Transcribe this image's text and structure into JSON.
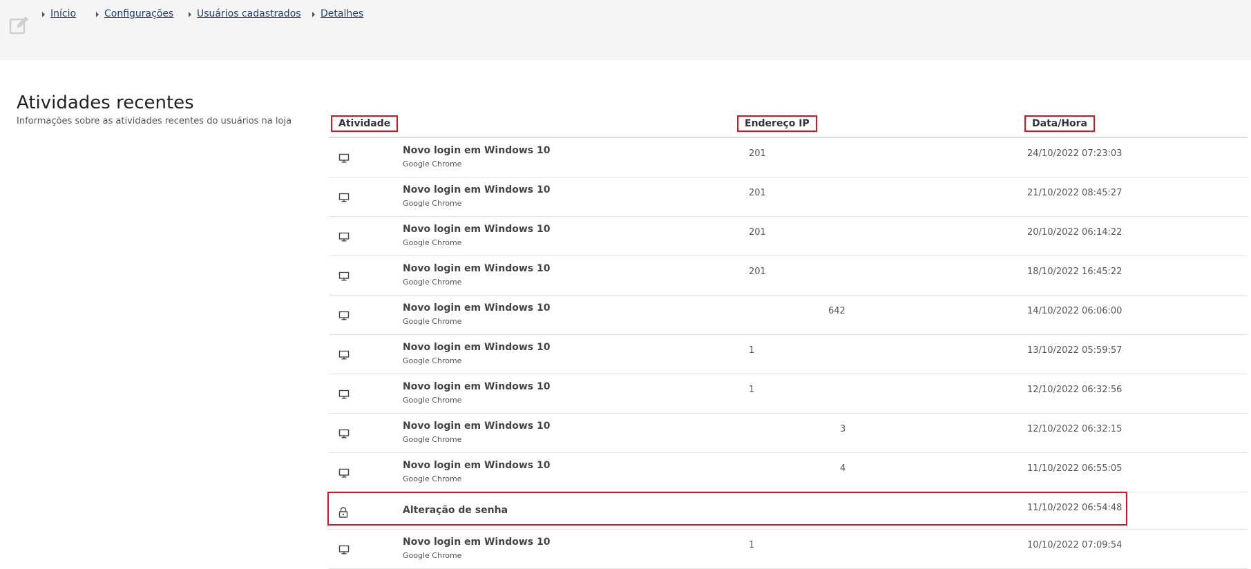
{
  "breadcrumb": [
    {
      "label": "Início"
    },
    {
      "label": "Configurações"
    },
    {
      "label": "Usuários cadastrados"
    },
    {
      "label": "Detalhes"
    }
  ],
  "section": {
    "title": "Atividades recentes",
    "subtitle": "Informações sobre as atividades recentes do usuários na loja"
  },
  "table": {
    "headers": {
      "activity": "Atividade",
      "ip": "Endereço IP",
      "date": "Data/Hora"
    },
    "rows": [
      {
        "icon": "monitor-icon",
        "title": "Novo login em Windows 10",
        "subtitle": "Google Chrome",
        "ip": "201",
        "date": "24/10/2022 07:23:03"
      },
      {
        "icon": "monitor-icon",
        "title": "Novo login em Windows 10",
        "subtitle": "Google Chrome",
        "ip": "201",
        "date": "21/10/2022 08:45:27"
      },
      {
        "icon": "monitor-icon",
        "title": "Novo login em Windows 10",
        "subtitle": "Google Chrome",
        "ip": "201",
        "date": "20/10/2022 06:14:22"
      },
      {
        "icon": "monitor-icon",
        "title": "Novo login em Windows 10",
        "subtitle": "Google Chrome",
        "ip": "201",
        "date": "18/10/2022 16:45:22"
      },
      {
        "icon": "monitor-icon",
        "title": "Novo login em Windows 10",
        "subtitle": "Google Chrome",
        "ip": "642",
        "date": "14/10/2022 06:06:00"
      },
      {
        "icon": "monitor-icon",
        "title": "Novo login em Windows 10",
        "subtitle": "Google Chrome",
        "ip": "1",
        "date": "13/10/2022 05:59:57"
      },
      {
        "icon": "monitor-icon",
        "title": "Novo login em Windows 10",
        "subtitle": "Google Chrome",
        "ip": "1",
        "date": "12/10/2022 06:32:56"
      },
      {
        "icon": "monitor-icon",
        "title": "Novo login em Windows 10",
        "subtitle": "Google Chrome",
        "ip": "3",
        "date": "12/10/2022 06:32:15"
      },
      {
        "icon": "monitor-icon",
        "title": "Novo login em Windows 10",
        "subtitle": "Google Chrome",
        "ip": "4",
        "date": "11/10/2022 06:55:05"
      },
      {
        "icon": "lock-icon",
        "title": "Alteração de senha",
        "subtitle": "",
        "ip": "",
        "date": "11/10/2022 06:54:48",
        "highlighted": true
      },
      {
        "icon": "monitor-icon",
        "title": "Novo login em Windows 10",
        "subtitle": "Google Chrome",
        "ip": "1",
        "date": "10/10/2022 07:09:54"
      }
    ]
  },
  "colors": {
    "highlight": "#e0101c",
    "link": "#1e3f73",
    "topbar": "#f5f5f5"
  }
}
